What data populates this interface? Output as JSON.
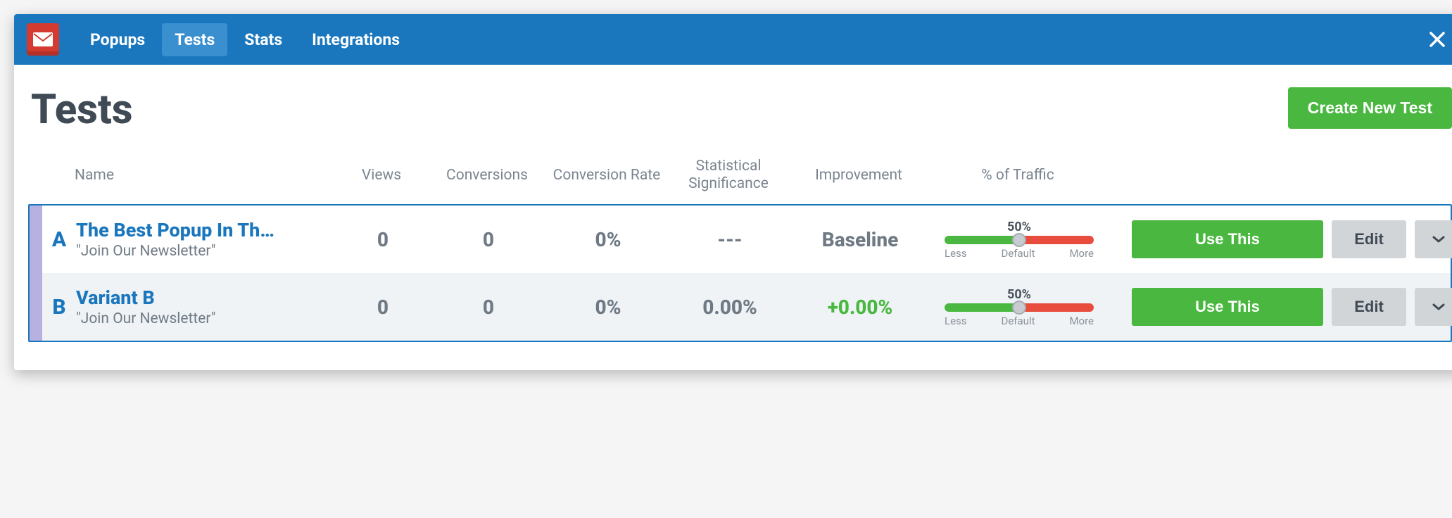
{
  "nav": {
    "items": [
      {
        "label": "Popups",
        "active": false
      },
      {
        "label": "Tests",
        "active": true
      },
      {
        "label": "Stats",
        "active": false
      },
      {
        "label": "Integrations",
        "active": false
      }
    ]
  },
  "page": {
    "title": "Tests",
    "create_button": "Create New Test"
  },
  "columns": {
    "name": "Name",
    "views": "Views",
    "conversions": "Conversions",
    "conversion_rate": "Conversion Rate",
    "statistical_significance": "Statistical Significance",
    "improvement": "Improvement",
    "traffic": "% of Traffic"
  },
  "slider_labels": {
    "less": "Less",
    "default": "Default",
    "more": "More"
  },
  "actions": {
    "use_this": "Use This",
    "edit": "Edit"
  },
  "variants": [
    {
      "letter": "A",
      "name": "The Best Popup In Th…",
      "subtitle": "\"Join Our Newsletter\"",
      "views": "0",
      "conversions": "0",
      "conversion_rate": "0%",
      "significance": "---",
      "improvement": "Baseline",
      "improvement_color": "gray",
      "traffic_pct": "50%"
    },
    {
      "letter": "B",
      "name": "Variant B",
      "subtitle": "\"Join Our Newsletter\"",
      "views": "0",
      "conversions": "0",
      "conversion_rate": "0%",
      "significance": "0.00%",
      "improvement": "+0.00%",
      "improvement_color": "green",
      "traffic_pct": "50%"
    }
  ]
}
